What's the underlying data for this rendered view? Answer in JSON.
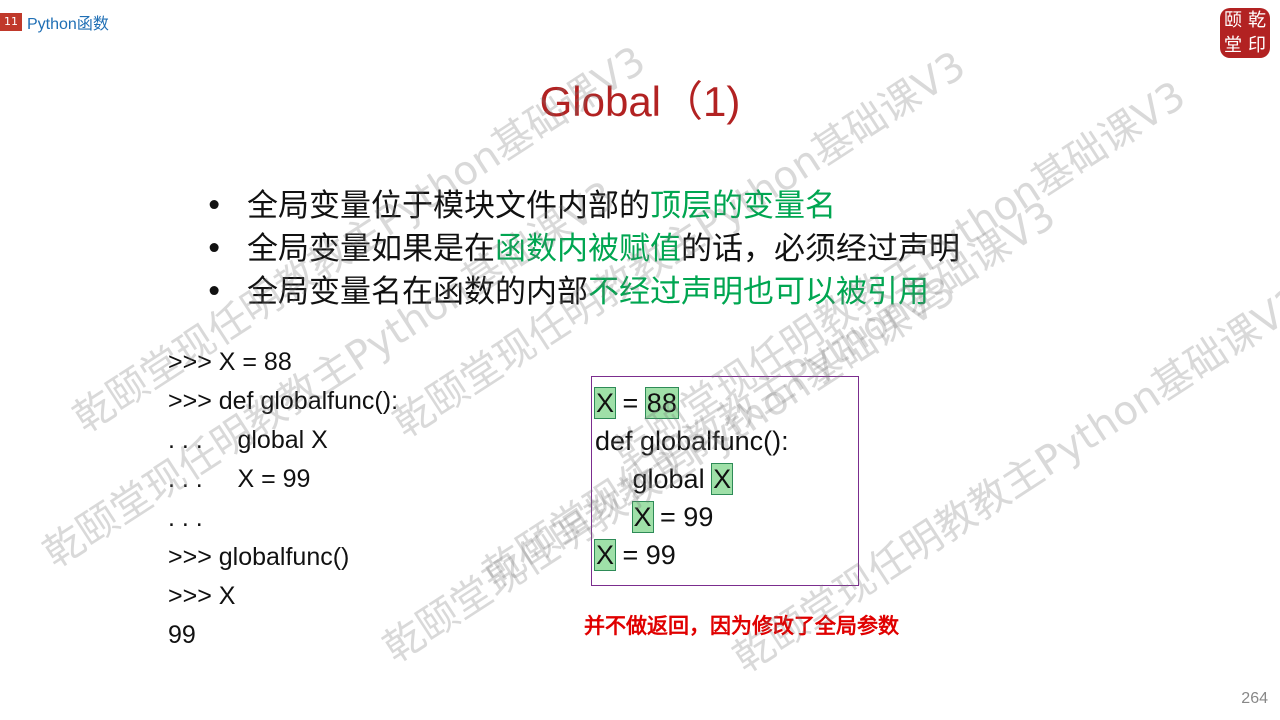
{
  "header": {
    "chapter_number": "11",
    "chapter_title": "Python函数"
  },
  "seal": {
    "chars": [
      "颐",
      "乾",
      "堂",
      "印"
    ]
  },
  "slide": {
    "title": "Global（1)",
    "bullets": [
      {
        "plain": "全局变量位于模块文件内部的",
        "highlight": "顶层的变量名",
        "tail": ""
      },
      {
        "plain": "全局变量如果是在",
        "highlight": "函数内被赋值",
        "tail": "的话，必须经过声明"
      },
      {
        "plain": "全局变量名在函数的内部",
        "highlight": "不经过声明也可以被引用",
        "tail": ""
      }
    ],
    "bullet_symbol": "•",
    "code_left": [
      ">>> X = 88",
      ">>> def globalfunc():",
      ". . .     global X",
      ". . .     X = 99",
      ". . .",
      ">>> globalfunc()",
      ">>> X",
      "99"
    ],
    "code_right": {
      "l1_a": "X",
      "l1_b": " = ",
      "l1_c": "88",
      "l2": "def globalfunc():",
      "l3_a": "     global ",
      "l3_b": "X",
      "l4_indent": "     ",
      "l4_a": "X",
      "l4_b": " = 99",
      "l5_a": "X",
      "l5_b": " = 99"
    },
    "note": "并不做返回，因为修改了全局参数",
    "page_number": "264"
  },
  "watermark": {
    "text": "乾颐堂现任明教教主Python基础课V3"
  }
}
